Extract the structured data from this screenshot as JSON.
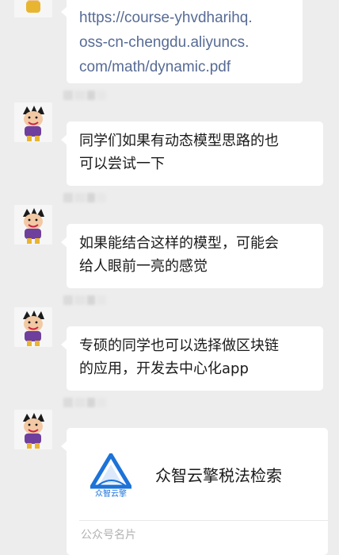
{
  "colors": {
    "background": "#ededed",
    "bubble": "#ffffff",
    "link": "#576b95",
    "text": "#1a1a1a",
    "muted": "#b2b2b2"
  },
  "messages": [
    {
      "type": "link",
      "lines": [
        "https://course-yhvdharihq.",
        "oss-cn-chengdu.aliyuncs.",
        "com/math/dynamic.pdf"
      ]
    },
    {
      "type": "text",
      "lines": [
        "同学们如果有动态模型思路的也",
        "可以尝试一下"
      ]
    },
    {
      "type": "text",
      "lines": [
        "如果能结合这样的模型，可能会",
        "给人眼前一亮的感觉"
      ]
    },
    {
      "type": "text",
      "lines": [
        "专硕的同学也可以选择做区块链",
        "的应用，开发去中心化app"
      ]
    }
  ],
  "card": {
    "title": "众智云擎税法检索",
    "logo_text": "众智云擎",
    "footer": "公众号名片",
    "logo_icon": "triangle-logo-icon"
  }
}
